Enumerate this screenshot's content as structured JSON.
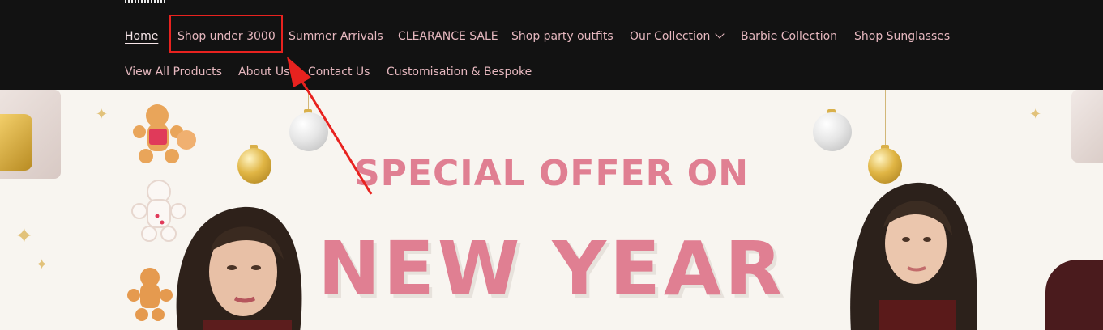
{
  "nav": {
    "items": [
      {
        "label": "Home",
        "active": true
      },
      {
        "label": "Shop under 3000"
      },
      {
        "label": "Summer Arrivals"
      },
      {
        "label": "CLEARANCE SALE"
      },
      {
        "label": "Shop party outfits"
      },
      {
        "label": "Our Collection",
        "has_dropdown": true
      },
      {
        "label": "Barbie Collection"
      },
      {
        "label": "Shop Sunglasses"
      },
      {
        "label": "View All Products"
      },
      {
        "label": "About Us"
      },
      {
        "label": "Contact Us"
      },
      {
        "label": "Customisation & Bespoke"
      }
    ],
    "icons": {
      "dropdown": "chevron-down-icon"
    }
  },
  "annotation": {
    "highlight_target": "Shop under 3000",
    "highlight_color": "#e8221f",
    "arrow_color": "#e8221f"
  },
  "banner": {
    "line1": "SPECIAL OFFER ON",
    "line2": "NEW YEAR",
    "text_color": "#e07f92",
    "background": "#f8f5f0"
  },
  "colors": {
    "nav_bg": "#121212",
    "nav_text": "#e6b8bf"
  }
}
